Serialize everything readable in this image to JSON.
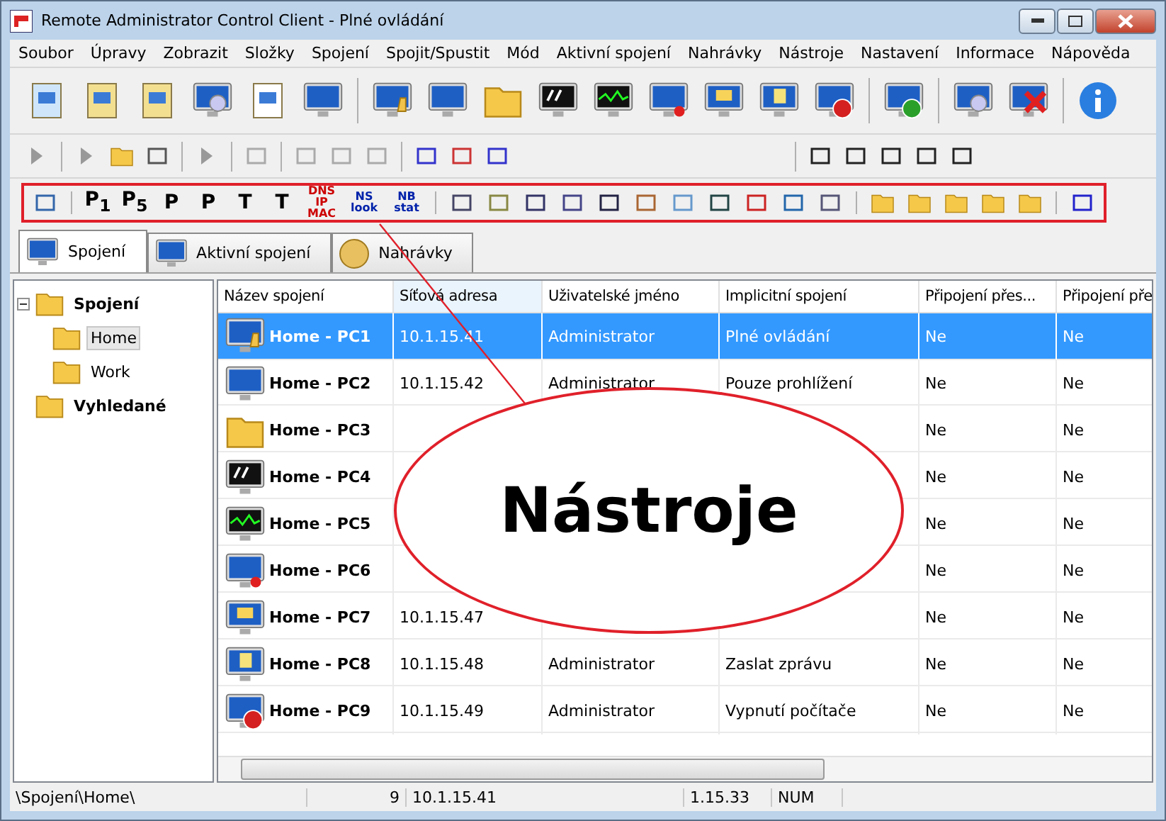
{
  "window": {
    "title": "Remote Administrator Control Client - Plné ovládání"
  },
  "menu": [
    "Soubor",
    "Úpravy",
    "Zobrazit",
    "Složky",
    "Spojení",
    "Spojit/Spustit",
    "Mód",
    "Aktivní spojení",
    "Nahrávky",
    "Nástroje",
    "Nastavení",
    "Informace",
    "Nápověda"
  ],
  "tools_toolbar": {
    "labels": [
      "P$_{1}$",
      "P$_{5}$",
      "P",
      "P",
      "T",
      "T",
      "DNS IP MAC",
      "NS look",
      "NB stat"
    ]
  },
  "tabs": [
    {
      "label": "Spojení",
      "selected": true
    },
    {
      "label": "Aktivní spojení",
      "selected": false
    },
    {
      "label": "Nahrávky",
      "selected": false
    }
  ],
  "tree": [
    {
      "label": "Spojení",
      "expanded": true,
      "selected": false,
      "children": [
        {
          "label": "Home",
          "selected": true
        },
        {
          "label": "Work",
          "selected": false
        }
      ]
    },
    {
      "label": "Vyhledané",
      "selected": false
    }
  ],
  "table": {
    "columns": [
      "Název spojení",
      "Síťová adresa",
      "Uživatelské jméno",
      "Implicitní spojení",
      "Připojení přes...",
      "Připojení pře"
    ],
    "rows": [
      {
        "selected": true,
        "cells": [
          "Home - PC1",
          "10.1.15.41",
          "Administrator",
          "Plné ovládání",
          "Ne",
          "Ne"
        ]
      },
      {
        "selected": false,
        "cells": [
          "Home - PC2",
          "10.1.15.42",
          "Administrator",
          "Pouze prohlížení",
          "Ne",
          "Ne"
        ]
      },
      {
        "selected": false,
        "cells": [
          "Home - PC3",
          "",
          "",
          "",
          "Ne",
          "Ne"
        ]
      },
      {
        "selected": false,
        "cells": [
          "Home - PC4",
          "",
          "",
          "",
          "Ne",
          "Ne"
        ]
      },
      {
        "selected": false,
        "cells": [
          "Home - PC5",
          "",
          "",
          "",
          "Ne",
          "Ne"
        ]
      },
      {
        "selected": false,
        "cells": [
          "Home - PC6",
          "",
          "",
          "",
          "Ne",
          "Ne"
        ]
      },
      {
        "selected": false,
        "cells": [
          "Home - PC7",
          "10.1.15.47",
          "",
          "",
          "Ne",
          "Ne"
        ]
      },
      {
        "selected": false,
        "cells": [
          "Home - PC8",
          "10.1.15.48",
          "Administrator",
          "Zaslat zprávu",
          "Ne",
          "Ne"
        ]
      },
      {
        "selected": false,
        "cells": [
          "Home - PC9",
          "10.1.15.49",
          "Administrator",
          "Vypnutí počítače",
          "Ne",
          "Ne"
        ]
      }
    ]
  },
  "callout": {
    "label": "Nástroje"
  },
  "status_bar": [
    "\\Spojení\\Home\\",
    "9",
    "10.1.15.41",
    "1.15.33",
    "NUM"
  ]
}
